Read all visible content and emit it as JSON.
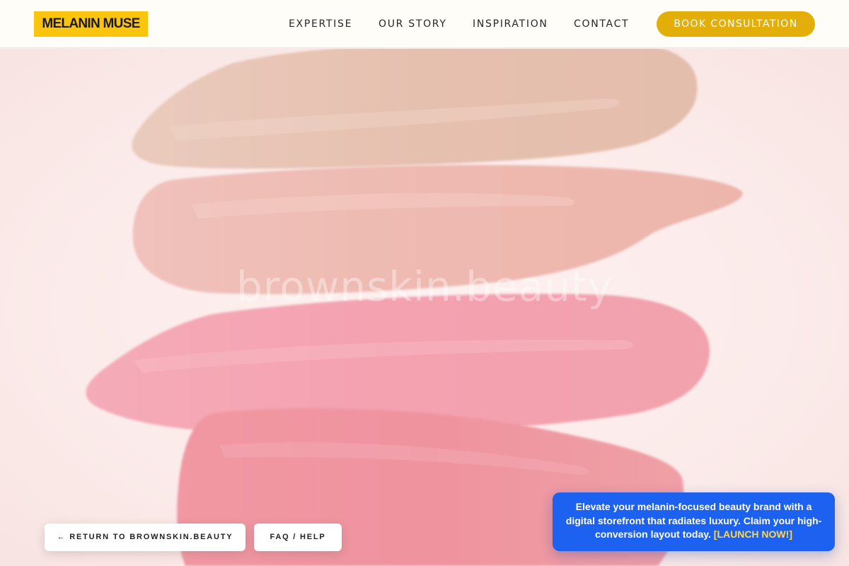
{
  "header": {
    "logo": "MELANIN MUSE",
    "nav": [
      {
        "label": "EXPERTISE"
      },
      {
        "label": "OUR STORY"
      },
      {
        "label": "INSPIRATION"
      },
      {
        "label": "CONTACT"
      }
    ],
    "cta_label": "BOOK CONSULTATION"
  },
  "hero": {
    "watermark": "brownskin.beauty",
    "swatch_colors": [
      "#e8c2b2",
      "#efbab3",
      "#f3a3b1",
      "#ef97a0"
    ]
  },
  "buttons": {
    "return_label": "← RETURN TO BROWNSKIN.BEAUTY",
    "faq_label": "FAQ / HELP"
  },
  "promo": {
    "text": "Elevate your melanin-focused beauty brand with a digital storefront that radiates luxury. Claim your high-conversion layout today.",
    "link_label": "[LAUNCH NOW!]"
  },
  "colors": {
    "logo_bg": "#fcc50d",
    "cta_bg": "#e3ae07",
    "promo_bg": "#1d61f1",
    "promo_link": "#ffd84a"
  }
}
